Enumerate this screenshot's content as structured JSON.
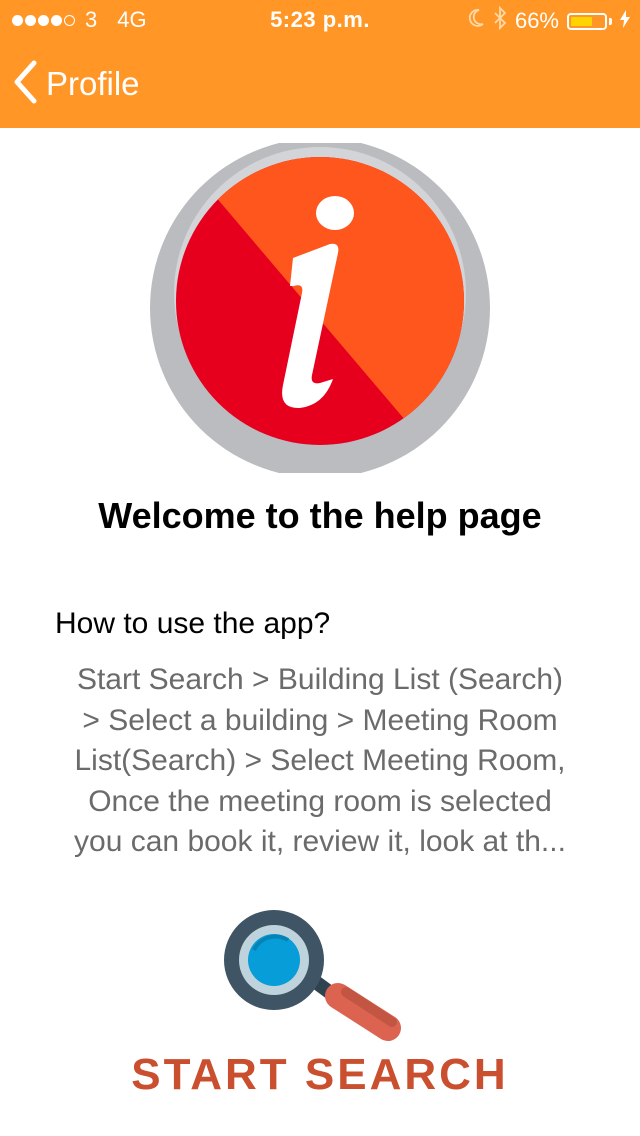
{
  "status_bar": {
    "carrier": "3",
    "network": "4G",
    "time": "5:23 p.m.",
    "battery": "66%",
    "battery_level": 0.66,
    "signal_strength": 4,
    "signal_max": 5
  },
  "nav": {
    "back_label": "Profile"
  },
  "main": {
    "welcome_title": "Welcome to the help page",
    "howto_heading": "How to use the app?",
    "description_lines": [
      "Start Search > Building List (Search)",
      "> Select a building > Meeting Room",
      "List(Search) > Select Meeting Room,",
      "Once the meeting room is selected",
      "you can book it, review it, look at th..."
    ],
    "start_search_label": "START SEARCH"
  },
  "icons": {
    "back": "chevron-left-icon",
    "info": "info-icon",
    "search": "magnifier-icon",
    "moon": "moon-icon",
    "bluetooth": "bluetooth-icon",
    "charging": "bolt-icon"
  },
  "colors": {
    "header_bg": "#FF9626",
    "info_red": "#E6001E",
    "info_orange": "#FF561D",
    "battery_fill": "#FFD400",
    "start_search_text": "#C94F2E",
    "description_text": "#6b6b6b"
  }
}
